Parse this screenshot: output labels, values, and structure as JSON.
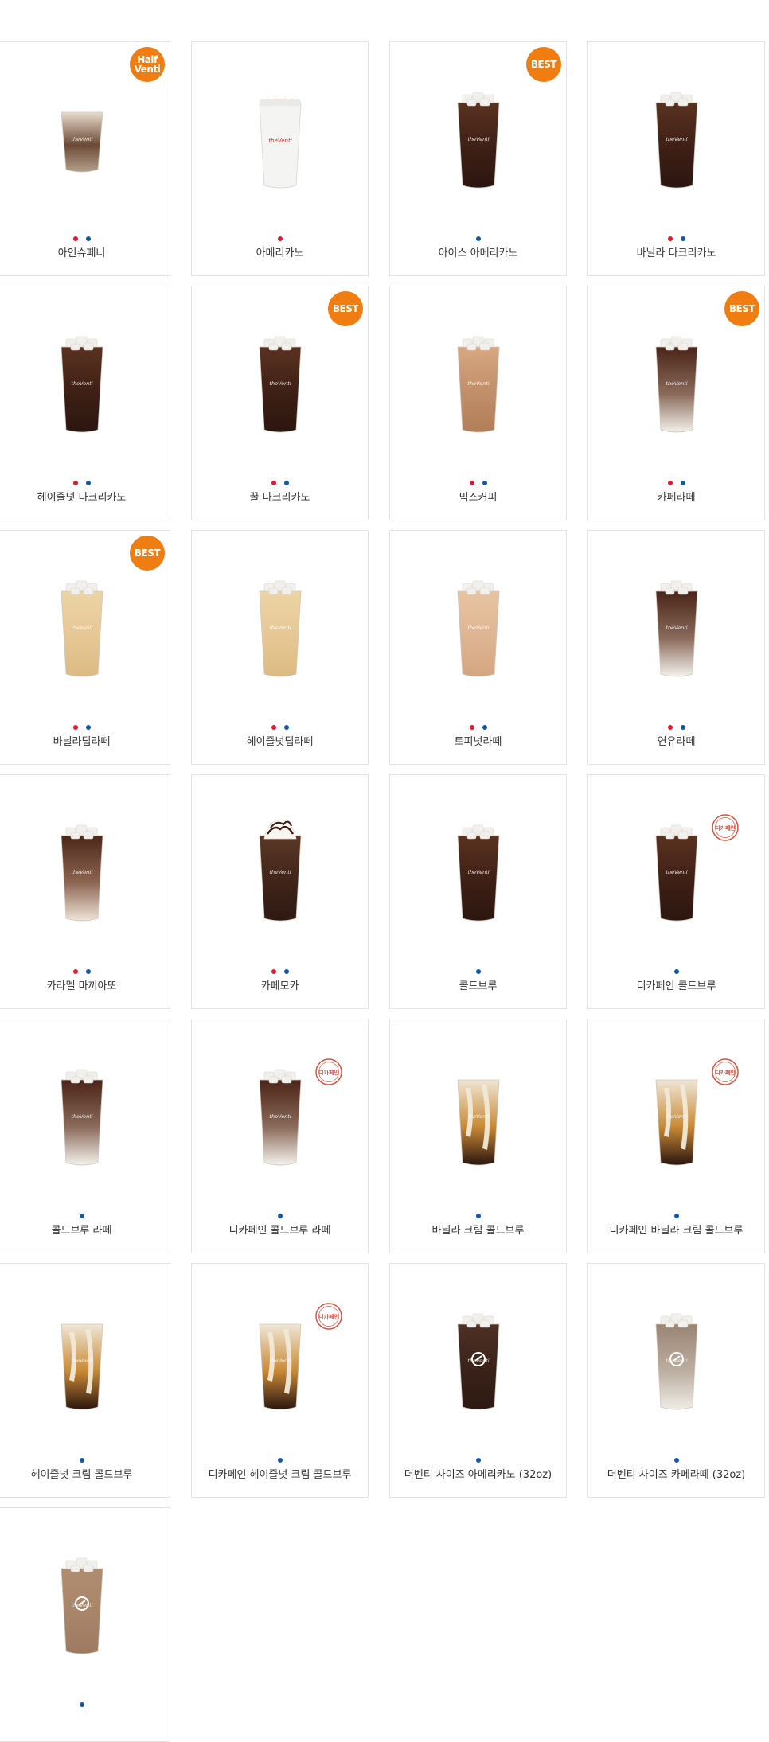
{
  "legend": {
    "hot_color": "#e3192f",
    "ice_color": "#1159a8",
    "badge_color": "#ef7d12"
  },
  "products": [
    {
      "name": "아인슈페너",
      "badge": "Half Venti",
      "hot": true,
      "ice": true,
      "decaf": false,
      "style": "einspanner"
    },
    {
      "name": "아메리카노",
      "badge": "",
      "hot": true,
      "ice": false,
      "decaf": false,
      "style": "hot"
    },
    {
      "name": "아이스 아메리카노",
      "badge": "BEST",
      "hot": false,
      "ice": true,
      "decaf": false,
      "style": "dark"
    },
    {
      "name": "바닐라 다크리카노",
      "badge": "",
      "hot": true,
      "ice": true,
      "decaf": false,
      "style": "dark"
    },
    {
      "name": "헤이즐넛 다크리카노",
      "badge": "",
      "hot": true,
      "ice": true,
      "decaf": false,
      "style": "dark"
    },
    {
      "name": "꿀 다크리카노",
      "badge": "BEST",
      "hot": true,
      "ice": true,
      "decaf": false,
      "style": "dark"
    },
    {
      "name": "믹스커피",
      "badge": "",
      "hot": true,
      "ice": true,
      "decaf": false,
      "style": "tan"
    },
    {
      "name": "카페라떼",
      "badge": "BEST",
      "hot": true,
      "ice": true,
      "decaf": false,
      "style": "latte"
    },
    {
      "name": "바닐라딥라떼",
      "badge": "BEST",
      "hot": true,
      "ice": true,
      "decaf": false,
      "style": "cream"
    },
    {
      "name": "헤이즐넛딥라떼",
      "badge": "",
      "hot": true,
      "ice": true,
      "decaf": false,
      "style": "cream"
    },
    {
      "name": "토피넛라떼",
      "badge": "",
      "hot": true,
      "ice": true,
      "decaf": false,
      "style": "toffee"
    },
    {
      "name": "연유라떼",
      "badge": "",
      "hot": true,
      "ice": true,
      "decaf": false,
      "style": "latte"
    },
    {
      "name": "카라멜 마끼아또",
      "badge": "",
      "hot": true,
      "ice": true,
      "decaf": false,
      "style": "macchiato"
    },
    {
      "name": "카페모카",
      "badge": "",
      "hot": true,
      "ice": true,
      "decaf": false,
      "style": "mocha"
    },
    {
      "name": "콜드브루",
      "badge": "",
      "hot": false,
      "ice": true,
      "decaf": false,
      "style": "dark"
    },
    {
      "name": "디카페인 콜드브루",
      "badge": "",
      "hot": false,
      "ice": true,
      "decaf": true,
      "style": "dark"
    },
    {
      "name": "콜드브루 라떼",
      "badge": "",
      "hot": false,
      "ice": true,
      "decaf": false,
      "style": "latte"
    },
    {
      "name": "디카페인 콜드브루 라떼",
      "badge": "",
      "hot": false,
      "ice": true,
      "decaf": true,
      "style": "latte"
    },
    {
      "name": "바닐라 크림 콜드브루",
      "badge": "",
      "hot": false,
      "ice": true,
      "decaf": false,
      "style": "creamcold"
    },
    {
      "name": "디카페인 바닐라 크림 콜드브루",
      "badge": "",
      "hot": false,
      "ice": true,
      "decaf": true,
      "style": "creamcold"
    },
    {
      "name": "헤이즐넛 크림 콜드브루",
      "badge": "",
      "hot": false,
      "ice": true,
      "decaf": false,
      "style": "creamcold"
    },
    {
      "name": "디카페인 헤이즐넛 크림 콜드브루",
      "badge": "",
      "hot": false,
      "ice": true,
      "decaf": true,
      "style": "creamcold"
    },
    {
      "name": "더벤티 사이즈 아메리카노 (32oz)",
      "badge": "",
      "hot": false,
      "ice": true,
      "decaf": false,
      "style": "big"
    },
    {
      "name": "더벤티 사이즈 카페라떼 (32oz)",
      "badge": "",
      "hot": false,
      "ice": true,
      "decaf": false,
      "style": "biglatte"
    },
    {
      "name": "",
      "badge": "",
      "hot": false,
      "ice": true,
      "decaf": false,
      "style": "bigtan"
    }
  ],
  "decaf_stamp_text": "디카페인",
  "brand_text": "theVenti"
}
